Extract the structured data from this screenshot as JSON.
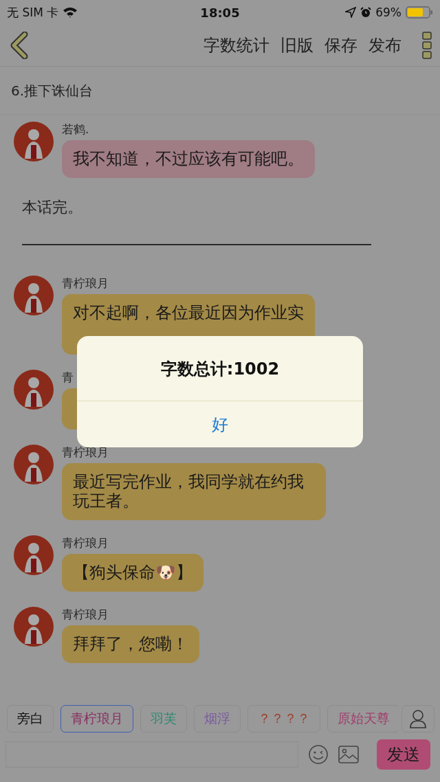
{
  "status_bar": {
    "carrier": "无 SIM 卡",
    "time": "18:05",
    "battery": "69%"
  },
  "nav": {
    "actions": [
      "字数统计",
      "旧版",
      "保存",
      "发布"
    ]
  },
  "chapter_title": "6.推下诛仙台",
  "chat": [
    {
      "kind": "message",
      "name": "若鹤.",
      "text": "我不知道，不过应该有可能吧。",
      "color": "#a07c84"
    },
    {
      "kind": "narration",
      "text": "本话完。"
    },
    {
      "kind": "rule"
    },
    {
      "kind": "message",
      "name": "青柠琅月",
      "text": "对不起啊，各位最近因为作业实",
      "color": "#a38a47",
      "covered": true
    },
    {
      "kind": "message",
      "name": "青",
      "color": "#a38a47"
    },
    {
      "kind": "message",
      "name": "青柠琅月",
      "text": "最近写完作业，我同学就在约我玩王者。",
      "color": "#a38a47"
    },
    {
      "kind": "message",
      "name": "青柠琅月",
      "text": "【狗头保命🐶】",
      "color": "#a38a47"
    },
    {
      "kind": "message",
      "name": "青柠琅月",
      "text": "拜拜了，您嘞！",
      "color": "#a38a47"
    }
  ],
  "roles": [
    {
      "label": "旁白",
      "color": "#111111",
      "selected": false
    },
    {
      "label": "青柠琅月",
      "color": "#8a2f63",
      "selected": true
    },
    {
      "label": "羽芙",
      "color": "#2f8a70",
      "selected": false
    },
    {
      "label": "烟浮",
      "color": "#7a5aa0",
      "selected": false
    },
    {
      "label": "？？？？",
      "color": "#a0402f",
      "selected": false
    },
    {
      "label": "原始天尊",
      "color": "#a0406f",
      "selected": false
    }
  ],
  "composer": {
    "send": "发送"
  },
  "alert": {
    "title": "字数总计:1002",
    "button": "好"
  }
}
